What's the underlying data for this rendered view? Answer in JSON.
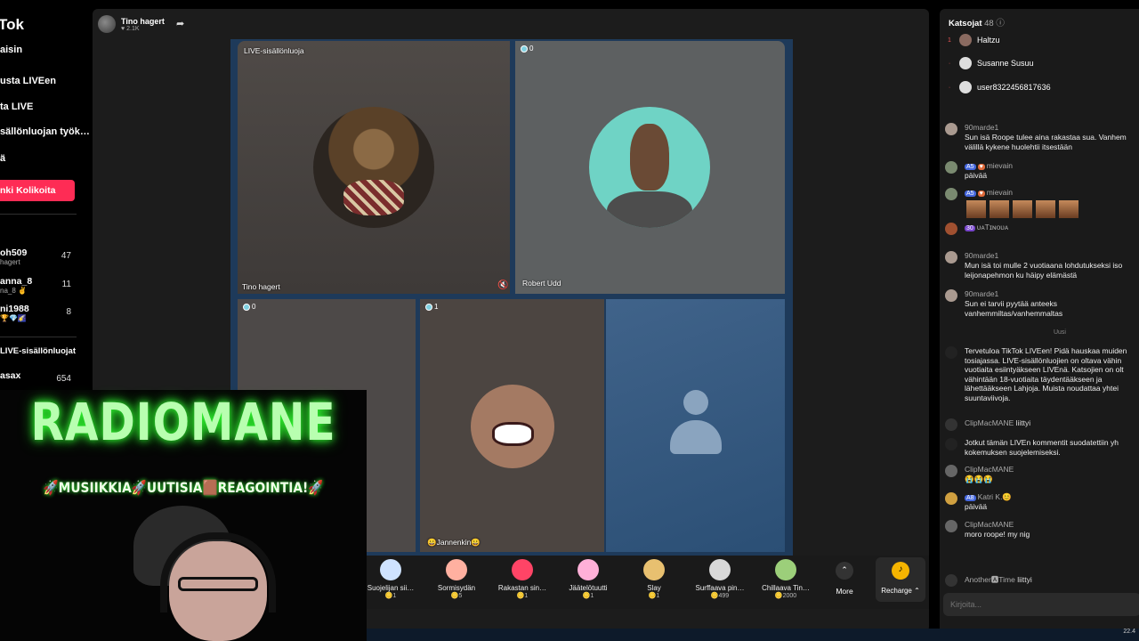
{
  "sidebar": {
    "logo": "Tok",
    "nav": [
      "aisin",
      "usta LIVEen",
      "ta LIVE",
      "sällönluojan työk…",
      "ä"
    ],
    "follow_button": "nki Kolikoita",
    "creators": [
      {
        "name": "oh509",
        "sub": "hagert",
        "count": "47"
      },
      {
        "name": "anna_8",
        "sub": "na_8 ✌",
        "count": "11"
      },
      {
        "name": "ni1988",
        "sub": "🏆💎🌠",
        "count": "8"
      }
    ],
    "section_title": "LIVE-sisällönluojat",
    "section_item": {
      "name": "asax",
      "count": "654"
    }
  },
  "host": {
    "name": "Tino hagert",
    "likes": "♥ 2.1K"
  },
  "tiles": [
    {
      "label_top": "LIVE-sisällönluoja",
      "label_bottom": "Tino hagert"
    },
    {
      "badge": "0",
      "label_bottom": "Robert Udd"
    },
    {
      "badge": "0"
    },
    {
      "badge": "1",
      "label_bottom": "😀Jannenkin😀"
    },
    {}
  ],
  "gifts": [
    {
      "name": "Suojelijan sii…",
      "price": "1",
      "color": "#cfe3ff"
    },
    {
      "name": "Sormisydän",
      "price": "5",
      "color": "#ffb0a0"
    },
    {
      "name": "Rakastan sin…",
      "price": "1",
      "color": "#ff4466"
    },
    {
      "name": "Jäätelötuutti",
      "price": "1",
      "color": "#ffb0d8"
    },
    {
      "name": "Slay",
      "price": "1",
      "color": "#e8c070"
    },
    {
      "name": "Surffaava pin…",
      "price": "499",
      "color": "#d8d8d8"
    },
    {
      "name": "Chillaava Tin…",
      "price": "2000",
      "color": "#9ccf7a"
    }
  ],
  "more_label": "More",
  "recharge_label": "Recharge ⌃",
  "chat": {
    "viewers_label": "Katsojat",
    "viewers_count": "48",
    "viewers": [
      {
        "rank": "1",
        "name": "Haltzu"
      },
      {
        "rank": "",
        "name": "Susanne Susuu"
      },
      {
        "rank": "",
        "name": "user8322456817636"
      }
    ],
    "messages": [
      {
        "user": "90marde1",
        "text": "Sun isä Roope tulee aina rakastaa sua. Vanhem välillä kykene huolehtii itsestään"
      },
      {
        "user": "mievain",
        "text": "päivää"
      },
      {
        "user": "mievain",
        "text": ""
      },
      {
        "user": "ᴜᴀTɪɴᴏᴜᴀ",
        "text": "😊😊😊😊"
      },
      {
        "user": "90marde1",
        "text": "Mun isä toi mulle 2 vuotiaana lohdutukseksi iso leijonapehmon ku häipy elämästä"
      },
      {
        "user": "90marde1",
        "text": "Sun ei tarvii pyytää anteeks vanhemmiltas/vanhemmaltas"
      },
      {
        "user": "",
        "text": "Tervetuloa TikTok LIVEen! Pidä hauskaa muiden tosiajassa. LIVE-sisällönluojien on oltava vähin vuotiaita esiintyäkseen LIVEnä. Katsojien on olt vähintään 18-vuotiaita täydentääkseen ja lähettääkseen Lahjoja. Muista noudattaa yhtei suuntaviivoja."
      },
      {
        "user": "ClipMacMANE",
        "text": "liittyi"
      },
      {
        "user": "",
        "text": "Jotkut tämän LIVEn kommentit suodatettiin yh kokemuksen suojelemiseksi."
      },
      {
        "user": "ClipMacMANE",
        "text": "😭😭😭"
      },
      {
        "user": "Katri K.😊",
        "text": "päivää"
      },
      {
        "user": "ClipMacMANE",
        "text": "moro roope! my nig"
      },
      {
        "user": "Another🅰Time",
        "text": "liittyi"
      }
    ],
    "new_label": "Uusi",
    "input_placeholder": "Kirjoita..."
  },
  "overlay": {
    "title": "RADIOMANE",
    "tagline": "🚀MUSIIKKIA🚀UUTISIA🟫REAGOINTIA!🚀"
  },
  "taskbar": {
    "clock": "22.4"
  }
}
